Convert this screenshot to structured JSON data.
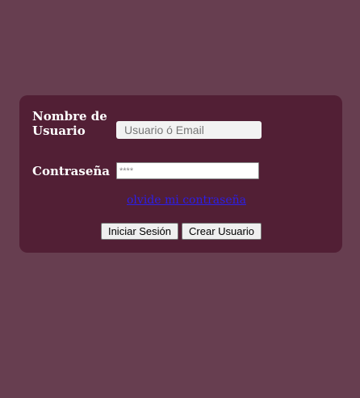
{
  "form": {
    "username_label": "Nombre de Usuario",
    "username_placeholder": "Usuario ó Email",
    "username_value": "",
    "password_label": "Contraseña",
    "password_placeholder": "****",
    "password_value": "",
    "forgot_link": "olvide mi contraseña",
    "login_button": "Iniciar Sesión",
    "create_button": "Crear Usuario"
  },
  "colors": {
    "page_background": "#673e50",
    "card_background": "#521f35",
    "label_text": "#ffffff",
    "link": "#2d1fe6"
  }
}
